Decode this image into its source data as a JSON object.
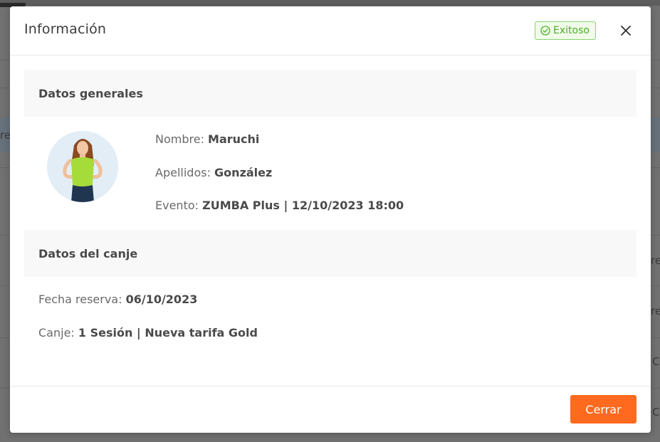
{
  "background": {
    "fragments": [
      "res",
      "re",
      "re",
      "C",
      "C"
    ]
  },
  "modal": {
    "title": "Información",
    "status_badge": "Exitoso",
    "sections": {
      "general": "Datos generales",
      "exchange": "Datos del canje"
    },
    "person": {
      "name_label": "Nombre: ",
      "name": "Maruchi",
      "surname_label": "Apellidos: ",
      "surname": "González",
      "event_label": "Evento: ",
      "event": "ZUMBA Plus | 12/10/2023 18:00"
    },
    "exchange": {
      "date_label": "Fecha reserva: ",
      "date": "06/10/2023",
      "canje_label": "Canje: ",
      "canje": "1 Sesión | Nueva tarifa Gold"
    },
    "footer": {
      "close_label": "Cerrar"
    }
  },
  "colors": {
    "accent": "#ff6a1f",
    "success": "#4caf2a"
  }
}
